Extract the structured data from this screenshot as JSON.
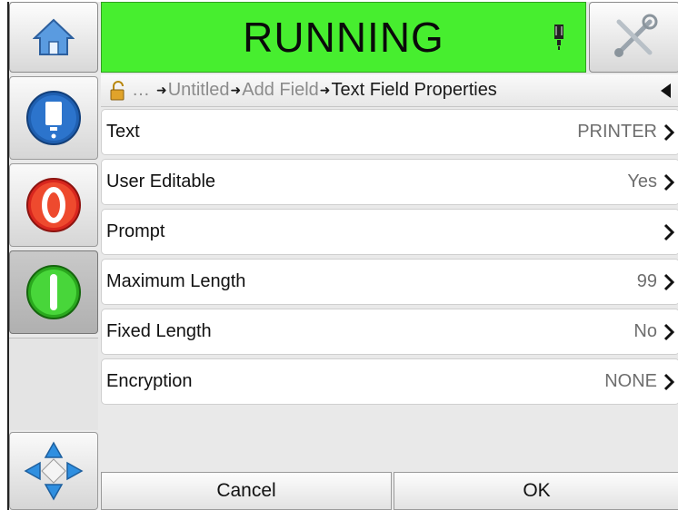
{
  "status": {
    "text": "RUNNING",
    "color": "#47ee2f",
    "icon": "ink-drop-icon"
  },
  "toolbar": {
    "home_icon": "home-icon",
    "tools_icon": "tools-icon"
  },
  "sidebar": {
    "buttons": [
      {
        "name": "ink-system-button",
        "icon": "ink-bottle-icon"
      },
      {
        "name": "stop-button",
        "icon": "stop-icon"
      },
      {
        "name": "start-button",
        "icon": "start-icon",
        "pressed": true
      }
    ],
    "nav_icon": "navigation-arrows-icon"
  },
  "breadcrumb": {
    "ellipsis": "…",
    "items": [
      "Untitled",
      "Add Field",
      "Text Field Properties"
    ],
    "arrow": "➜"
  },
  "properties": [
    {
      "label": "Text",
      "value": "PRINTER"
    },
    {
      "label": "User Editable",
      "value": "Yes"
    },
    {
      "label": "Prompt",
      "value": ""
    },
    {
      "label": "Maximum Length",
      "value": "99"
    },
    {
      "label": "Fixed Length",
      "value": "No"
    },
    {
      "label": "Encryption",
      "value": "NONE"
    }
  ],
  "actions": {
    "cancel_label": "Cancel",
    "ok_label": "OK"
  }
}
